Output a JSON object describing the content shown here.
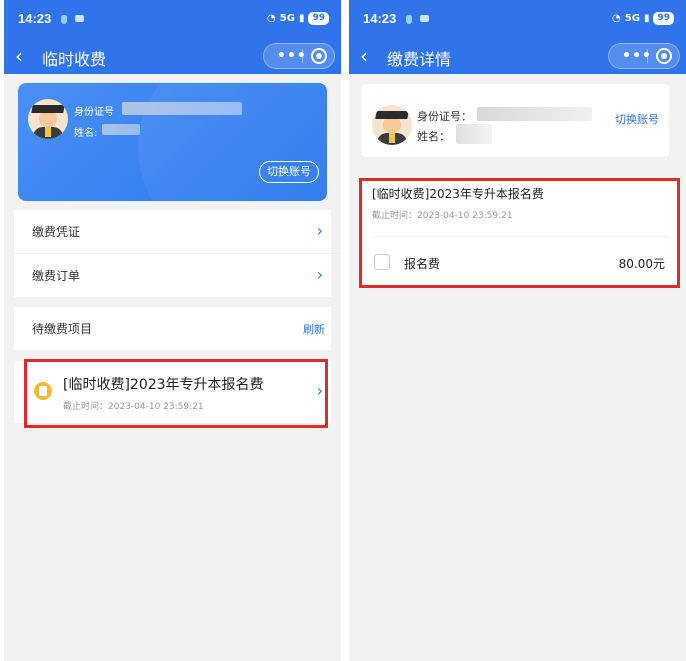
{
  "status_bar": {
    "time": "14:23",
    "signal": "5G",
    "battery": "99"
  },
  "screen1": {
    "title": "临时收费",
    "back_icon": "‹",
    "capsule": {
      "more_icon": "•••"
    },
    "account": {
      "id_label": "身份证号",
      "name_label": "姓名:",
      "switch_label": "切换账号"
    },
    "menu": [
      {
        "label": "缴费凭证"
      },
      {
        "label": "缴费订单"
      }
    ],
    "pending": {
      "header": "待缴费项目",
      "refresh_label": "刷新",
      "item": {
        "title": "[临时收费]2023年专升本报名费",
        "deadline": "截止时间：2023-04-10 23:59:21"
      }
    }
  },
  "screen2": {
    "title": "缴费详情",
    "back_icon": "‹",
    "account": {
      "id_label": "身份证号：",
      "name_label": "姓名：",
      "switch_label": "切换账号"
    },
    "detail": {
      "title": "[临时收费]2023年专升本报名费",
      "deadline": "截止时间：2023-04-10 23:59:21",
      "fee_name": "报名费",
      "fee_amount": "80.00元"
    }
  },
  "colors": {
    "primary": "#2f74ea",
    "highlight": "#e12a2a",
    "pending_icon": "#f5b933"
  }
}
